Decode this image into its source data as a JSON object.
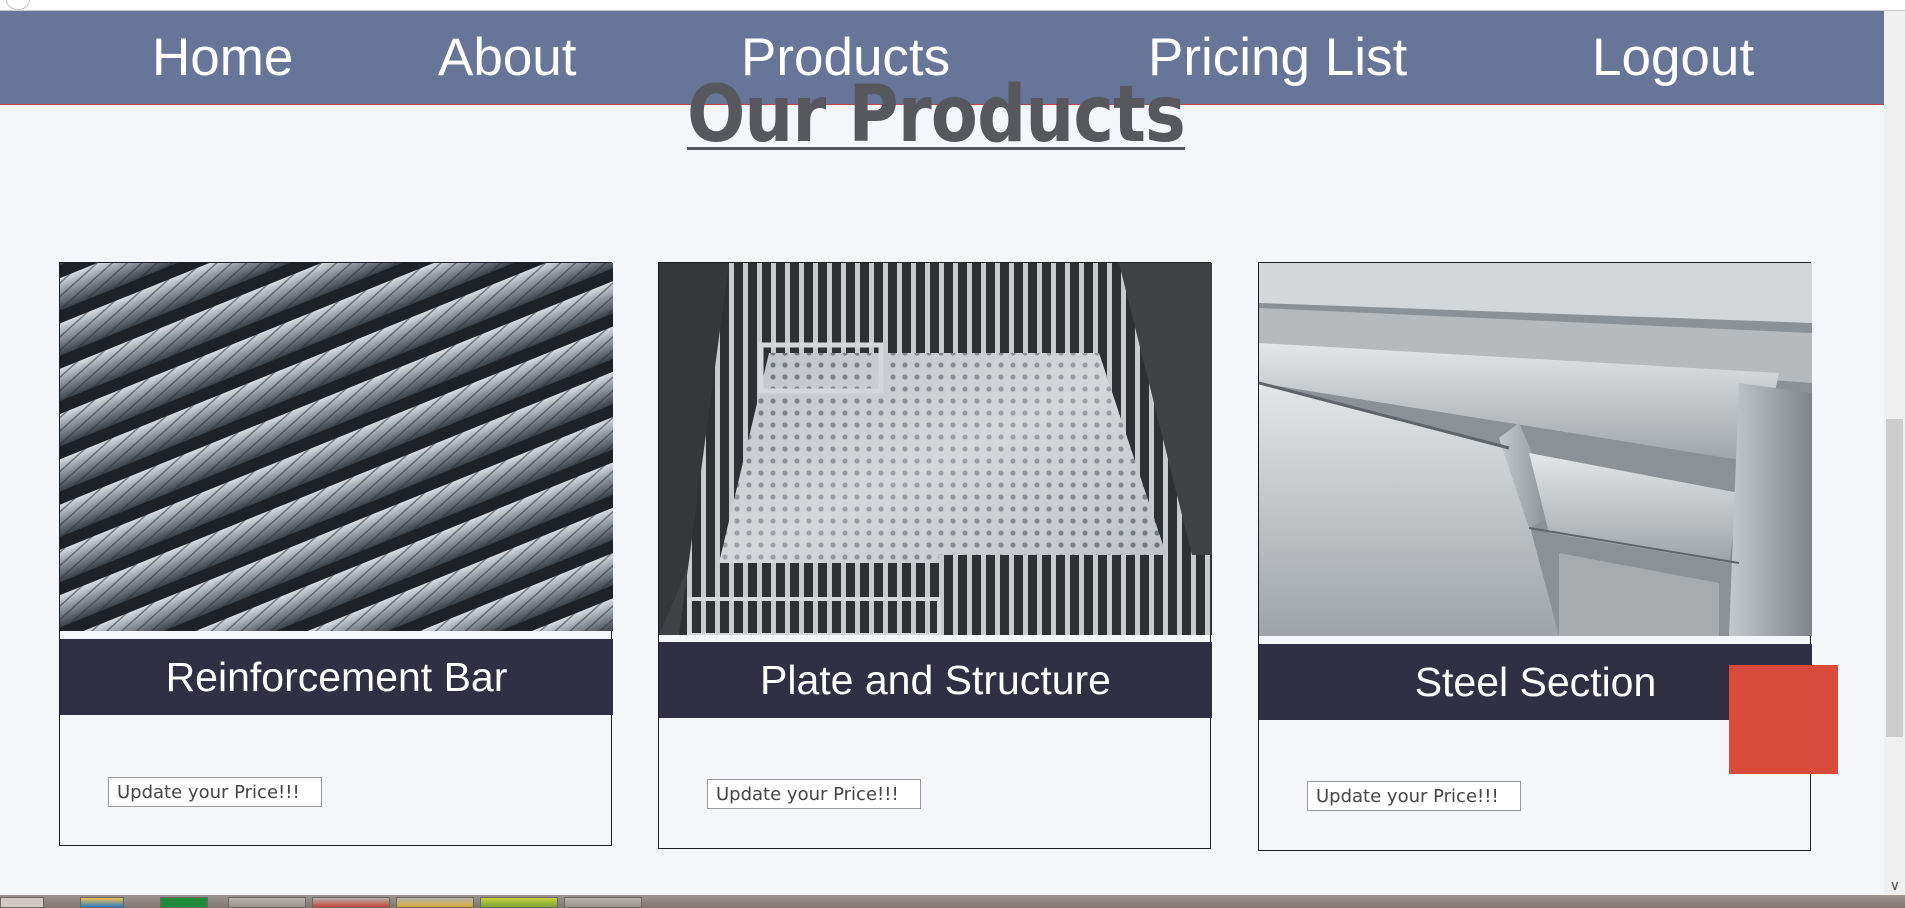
{
  "nav": {
    "home": "Home",
    "about": "About",
    "products": "Products",
    "pricing": "Pricing List",
    "logout": "Logout"
  },
  "page": {
    "title": "Our Products"
  },
  "products": [
    {
      "title": "Reinforcement Bar",
      "input_placeholder": "Update your Price!!!",
      "image": "rebar-photo"
    },
    {
      "title": "Plate and Structure",
      "input_placeholder": "Update your Price!!!",
      "image": "steel-grating-photo"
    },
    {
      "title": "Steel Section",
      "input_placeholder": "Update your Price!!!",
      "image": "steel-angle-photo"
    }
  ],
  "colors": {
    "navbar": "#677698",
    "card_title_bg": "#302f43",
    "accent_square": "#d84b3b",
    "page_bg": "#f5f6f9"
  }
}
